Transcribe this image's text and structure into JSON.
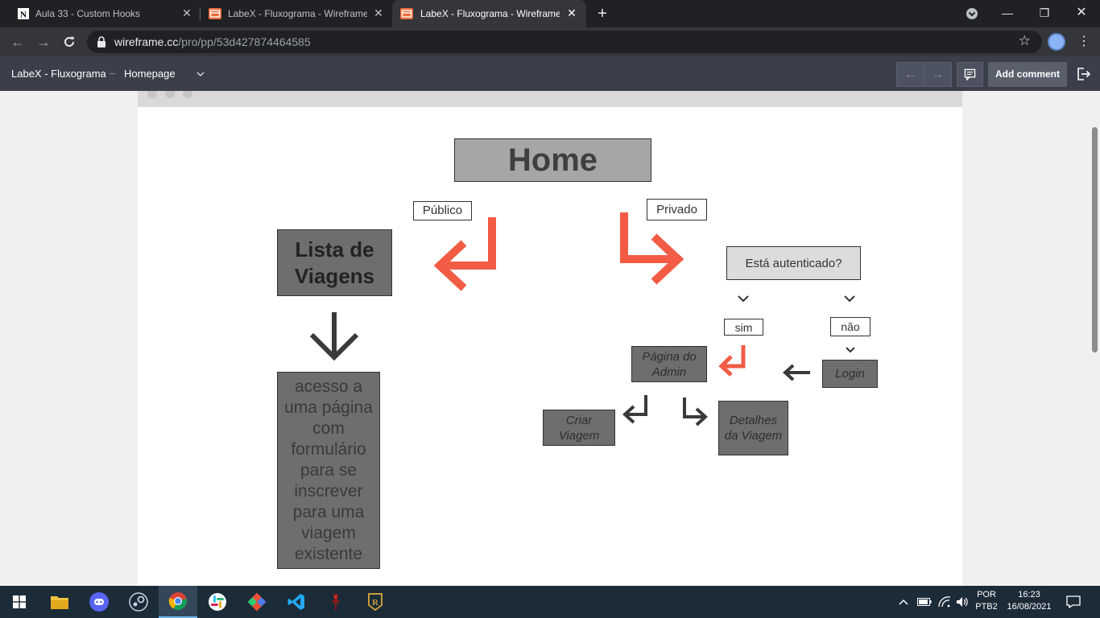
{
  "browser": {
    "tabs": [
      {
        "title": "Aula 33 - Custom Hooks",
        "icon": "notion-icon",
        "active": false
      },
      {
        "title": "LabeX - Fluxograma - Wireframe",
        "icon": "wireframe-icon",
        "active": false
      },
      {
        "title": "LabeX - Fluxograma - Wireframe",
        "icon": "wireframe-icon",
        "active": true
      }
    ],
    "new_tab": "+",
    "url_host": "wireframe.cc",
    "url_path": "/pro/pp/53d427874464585"
  },
  "appbar": {
    "project": "LabeX - Fluxograma",
    "separator": "–",
    "page": "Homepage",
    "add_comment": "Add comment"
  },
  "diagram": {
    "home": "Home",
    "publico": "Público",
    "privado": "Privado",
    "lista_line1": "Lista de",
    "lista_line2": "Viagens",
    "acesso": [
      "acesso a",
      "uma página",
      "com",
      "formulário",
      "para se",
      "inscrever",
      "para uma",
      "viagem",
      "existente"
    ],
    "esta_autenticado": "Está autenticado?",
    "sim": "sim",
    "nao": "não",
    "pagina_admin_line1": "Página do",
    "pagina_admin_line2": "Admin",
    "login": "Login",
    "criar_line1": "Criar",
    "criar_line2": "Viagem",
    "detalhes_line1": "Detalhes",
    "detalhes_line2": "da Viagem",
    "accent_color": "#f25c45",
    "dark_arrow_color": "#3a3a3a"
  },
  "taskbar": {
    "apps": [
      "start-icon",
      "file-explorer-icon",
      "discord-icon",
      "steam-icon",
      "chrome-icon",
      "slack-icon",
      "git-icon",
      "vscode-icon",
      "game-icon",
      "legends-icon"
    ],
    "lang_top": "POR",
    "lang_bottom": "PTB2",
    "time": "16:23",
    "date": "16/08/2021"
  }
}
